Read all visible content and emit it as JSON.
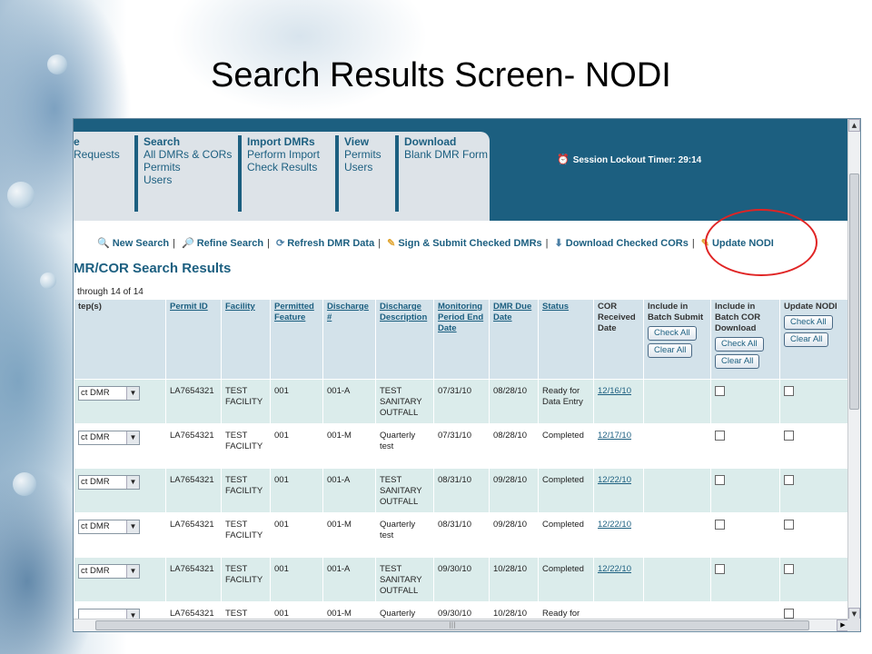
{
  "slide": {
    "title": "Search Results Screen- NODI"
  },
  "nav": {
    "tabs": [
      {
        "heading": "e",
        "items": [
          "Requests"
        ]
      },
      {
        "heading": "Search",
        "items": [
          "All DMRs & CORs",
          "Permits",
          "Users"
        ]
      },
      {
        "heading": "Import DMRs",
        "items": [
          "Perform Import",
          "Check Results"
        ]
      },
      {
        "heading": "View",
        "items": [
          "Permits",
          "Users"
        ]
      },
      {
        "heading": "Download",
        "items": [
          "Blank DMR Form"
        ]
      }
    ],
    "session_timer": "Session Lockout Timer: 29:14"
  },
  "actions": {
    "new_search": "New Search",
    "refine_search": "Refine Search",
    "refresh": "Refresh DMR Data",
    "sign_submit": "Sign & Submit Checked DMRs",
    "download_cors": "Download Checked CORs",
    "update_nodi": "Update NODI"
  },
  "results": {
    "heading": "MR/COR Search Results",
    "count": "through 14 of 14",
    "columns": {
      "step": "tep(s)",
      "permit_id": "Permit ID",
      "facility": "Facility",
      "permitted_feature": "Permitted Feature",
      "discharge": "Discharge #",
      "discharge_description": "Discharge Description",
      "monitoring_period": "Monitoring Period End Date",
      "dmr_due_date": "DMR Due Date",
      "status": "Status",
      "cor_received": "COR Received Date",
      "batch_submit": "Include in Batch Submit",
      "batch_cor": "Include in Batch COR Download",
      "update_nodi": "Update NODI"
    },
    "buttons": {
      "check_all": "Check All",
      "clear_all": "Clear All"
    },
    "rows": [
      {
        "step": "ct DMR",
        "permit": "LA7654321",
        "facility": "TEST FACILITY",
        "feature": "001",
        "discharge": "001-A",
        "description": "TEST SANITARY OUTFALL",
        "period": "07/31/10",
        "due": "08/28/10",
        "status": "Ready for Data Entry",
        "cor": "12/16/10"
      },
      {
        "step": "ct DMR",
        "permit": "LA7654321",
        "facility": "TEST FACILITY",
        "feature": "001",
        "discharge": "001-M",
        "description": "Quarterly test",
        "period": "07/31/10",
        "due": "08/28/10",
        "status": "Completed",
        "cor": "12/17/10"
      },
      {
        "step": "ct DMR",
        "permit": "LA7654321",
        "facility": "TEST FACILITY",
        "feature": "001",
        "discharge": "001-A",
        "description": "TEST SANITARY OUTFALL",
        "period": "08/31/10",
        "due": "09/28/10",
        "status": "Completed",
        "cor": "12/22/10"
      },
      {
        "step": "ct DMR",
        "permit": "LA7654321",
        "facility": "TEST FACILITY",
        "feature": "001",
        "discharge": "001-M",
        "description": "Quarterly test",
        "period": "08/31/10",
        "due": "09/28/10",
        "status": "Completed",
        "cor": "12/22/10"
      },
      {
        "step": "ct DMR",
        "permit": "LA7654321",
        "facility": "TEST FACILITY",
        "feature": "001",
        "discharge": "001-A",
        "description": "TEST SANITARY OUTFALL",
        "period": "09/30/10",
        "due": "10/28/10",
        "status": "Completed",
        "cor": "12/22/10"
      },
      {
        "step": "",
        "permit": "LA7654321",
        "facility": "TEST",
        "feature": "001",
        "discharge": "001-M",
        "description": "Quarterly",
        "period": "09/30/10",
        "due": "10/28/10",
        "status": "Ready for",
        "cor": ""
      }
    ]
  },
  "colors": {
    "brand": "#1c5f80",
    "row_alt": "#dbeceb",
    "header_bg": "#d3e2ea",
    "highlight": "#e02424"
  }
}
